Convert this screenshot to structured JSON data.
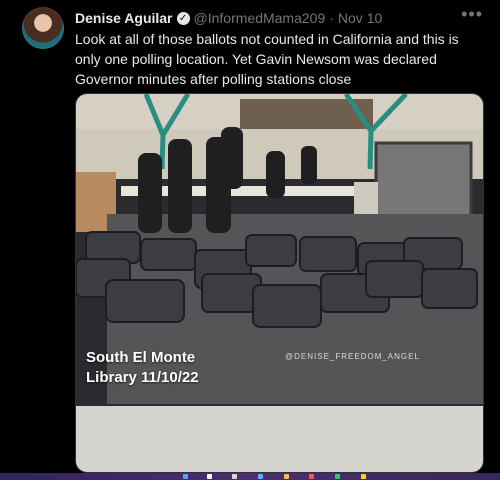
{
  "tweet": {
    "author_name": "Denise Aguilar",
    "verified_mark": "✓",
    "handle": "@InformedMama209",
    "separator": "·",
    "date": "Nov 10",
    "more": "•••",
    "body": "Look at all of those ballots not counted in California and this is only one polling location. Yet Gavin Newsom was declared Governor minutes after polling stations close"
  },
  "media": {
    "caption_line1": "South El Monte",
    "caption_line2": "Library 11/10/22",
    "watermark": "@DENISE_FREEDOM_ANGEL"
  },
  "colors": {
    "background": "#000000",
    "primary_text": "#e7e9ea",
    "secondary_text": "#71767b",
    "bag": "#3c3d42",
    "floor": "#4a4a4f",
    "taskbar": "#4e2d70"
  }
}
